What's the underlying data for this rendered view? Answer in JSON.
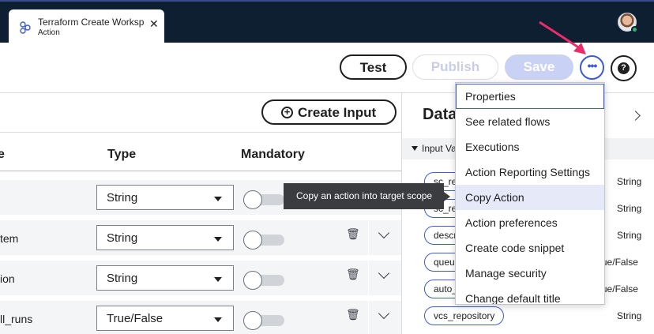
{
  "tab": {
    "title": "Terraform Create Workspace",
    "subtitle": "Action",
    "icon": "flow-nodes-icon",
    "close_glyph": "✕"
  },
  "toolbar": {
    "test_label": "Test",
    "publish_label": "Publish",
    "save_label": "Save",
    "more_glyph": "•••",
    "help_glyph": "?"
  },
  "inputs": {
    "create_label": "Create Input",
    "columns": [
      "e",
      "Type",
      "Mandatory"
    ],
    "rows": [
      {
        "name": "",
        "type": "String",
        "mandatory": false
      },
      {
        "name": "tem",
        "type": "String",
        "mandatory": false
      },
      {
        "name": "ion",
        "type": "String",
        "mandatory": false
      },
      {
        "name": "ll_runs",
        "type": "True/False",
        "mandatory": false
      }
    ]
  },
  "data_panel": {
    "title": "Data",
    "section_label": "Input Va",
    "items": [
      {
        "name": "sc_re",
        "type": "String"
      },
      {
        "name": "sc_re",
        "type": "String"
      },
      {
        "name": "descr",
        "type": "String"
      },
      {
        "name": "queu",
        "type": "True/False"
      },
      {
        "name": "auto_",
        "type": "True/False"
      },
      {
        "name": "vcs_repository",
        "type": "String"
      }
    ]
  },
  "menu": {
    "items": [
      "Properties",
      "See related flows",
      "Executions",
      "Action Reporting Settings",
      "Copy Action",
      "Action preferences",
      "Create code snippet",
      "Manage security",
      "Change default title"
    ],
    "focused_index": 0,
    "hovered_index": 4
  },
  "tooltip": {
    "text": "Copy an action into target scope"
  },
  "colors": {
    "topbar": "#0d1f30",
    "accent": "#3d5bd6",
    "annotation_arrow": "#ec2b6b"
  }
}
